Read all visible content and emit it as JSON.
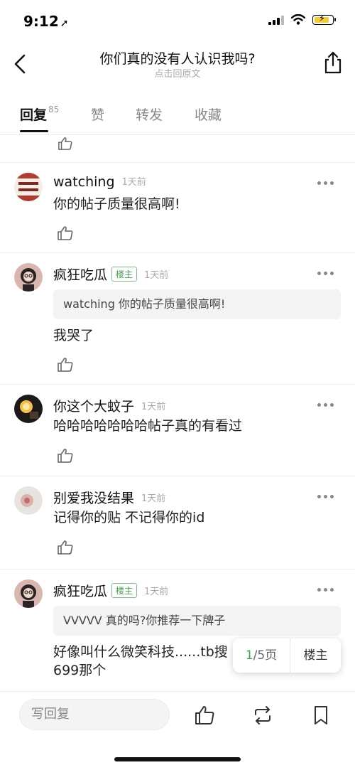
{
  "status": {
    "time": "9:12",
    "battery_color": "#f4cc35"
  },
  "header": {
    "title": "你们真的没有人认识我吗?",
    "subtitle": "点击回原文"
  },
  "tabs": [
    {
      "label": "回复",
      "count": "85"
    },
    {
      "label": "赞"
    },
    {
      "label": "转发"
    },
    {
      "label": "收藏"
    }
  ],
  "comments": [
    {
      "user": "watching",
      "time": "1天前",
      "text": "你的帖子质量很高啊!"
    },
    {
      "user": "疯狂吃瓜",
      "badge": "楼主",
      "time": "1天前",
      "quote": "watching 你的帖子质量很高啊!",
      "text": "我哭了"
    },
    {
      "user": "你这个大蚊子",
      "time": "1天前",
      "text": "哈哈哈哈哈哈哈帖子真的有看过"
    },
    {
      "user": "别爱我没结果",
      "time": "1天前",
      "text": "记得你的贴 不记得你的id"
    },
    {
      "user": "疯狂吃瓜",
      "badge": "楼主",
      "time": "1天前",
      "quote": "VVVVV 真的吗?你推荐一下牌子",
      "text_line1": "好像叫什么微笑科技......tb搜",
      "text_line2": "699那个"
    }
  ],
  "pager": {
    "current": "1",
    "total": "/5页",
    "floor_label": "楼主"
  },
  "bottom": {
    "reply_placeholder": "写回复"
  },
  "colors": {
    "accent_green": "#43a047"
  }
}
